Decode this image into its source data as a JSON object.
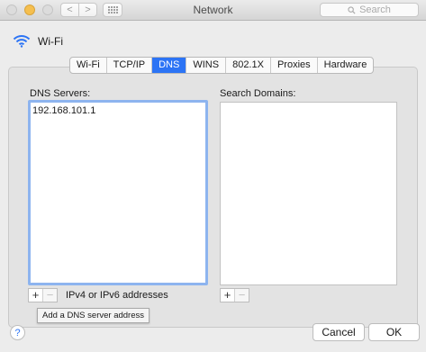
{
  "window": {
    "title": "Network",
    "search_placeholder": "Search",
    "back_glyph": "<",
    "forward_glyph": ">"
  },
  "interface": {
    "name": "Wi-Fi",
    "icon": "wifi-icon"
  },
  "tabs": [
    {
      "label": "Wi-Fi",
      "active": false
    },
    {
      "label": "TCP/IP",
      "active": false
    },
    {
      "label": "DNS",
      "active": true
    },
    {
      "label": "WINS",
      "active": false
    },
    {
      "label": "802.1X",
      "active": false
    },
    {
      "label": "Proxies",
      "active": false
    },
    {
      "label": "Hardware",
      "active": false
    }
  ],
  "dns": {
    "label": "DNS Servers:",
    "servers": [
      "192.168.101.1"
    ],
    "hint": "IPv4 or IPv6 addresses",
    "tooltip": "Add a DNS server address"
  },
  "search_domains": {
    "label": "Search Domains:",
    "domains": []
  },
  "controls": {
    "plus": "+",
    "minus": "−"
  },
  "footer": {
    "help": "?",
    "cancel": "Cancel",
    "ok": "OK"
  },
  "colors": {
    "accent": "#2c74f5",
    "focus_ring": "#8db4ef",
    "minimize": "#f5bf4f"
  }
}
